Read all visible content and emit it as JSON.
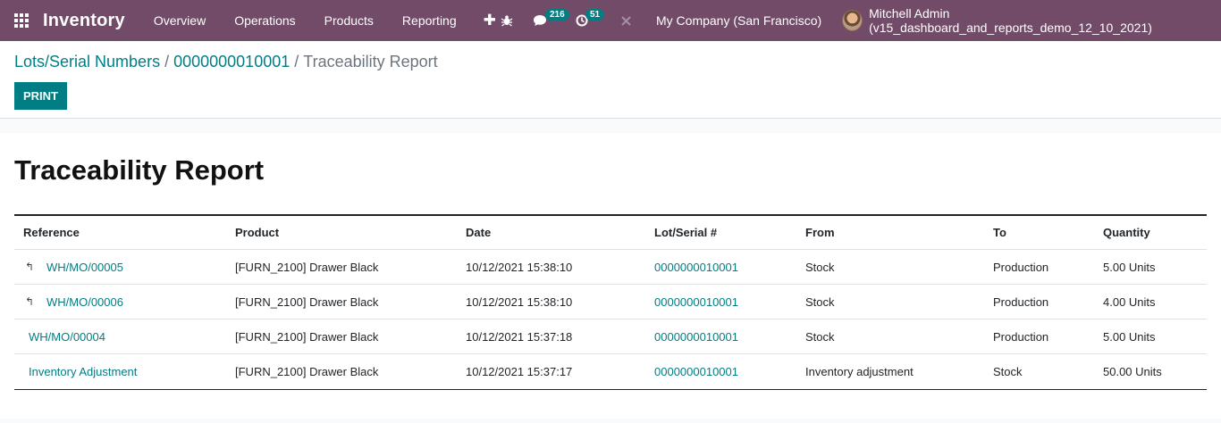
{
  "navbar": {
    "app_title": "Inventory",
    "menu": [
      "Overview",
      "Operations",
      "Products",
      "Reporting"
    ],
    "messages_count": "216",
    "activities_count": "51",
    "company": "My Company (San Francisco)",
    "user": "Mitchell Admin (v15_dashboard_and_reports_demo_12_10_2021)"
  },
  "breadcrumb": {
    "root": "Lots/Serial Numbers",
    "separator": "/",
    "record": "0000000010001",
    "current": "Traceability Report"
  },
  "actions": {
    "print_label": "PRINT"
  },
  "report": {
    "title": "Traceability Report",
    "columns": [
      "Reference",
      "Product",
      "Date",
      "Lot/Serial #",
      "From",
      "To",
      "Quantity"
    ],
    "rows": [
      {
        "reference": "WH/MO/00005",
        "product": "[FURN_2100] Drawer Black",
        "date": "10/12/2021 15:38:10",
        "lot": "0000000010001",
        "from": "Stock",
        "to": "Production",
        "quantity": "5.00 Units",
        "expandable": true
      },
      {
        "reference": "WH/MO/00006",
        "product": "[FURN_2100] Drawer Black",
        "date": "10/12/2021 15:38:10",
        "lot": "0000000010001",
        "from": "Stock",
        "to": "Production",
        "quantity": "4.00 Units",
        "expandable": true
      },
      {
        "reference": "WH/MO/00004",
        "product": "[FURN_2100] Drawer Black",
        "date": "10/12/2021 15:37:18",
        "lot": "0000000010001",
        "from": "Stock",
        "to": "Production",
        "quantity": "5.00 Units",
        "expandable": false
      },
      {
        "reference": "Inventory Adjustment",
        "product": "[FURN_2100] Drawer Black",
        "date": "10/12/2021 15:37:17",
        "lot": "0000000010001",
        "from": "Inventory adjustment",
        "to": "Stock",
        "quantity": "50.00 Units",
        "expandable": false
      }
    ]
  },
  "icons": {
    "apps": "apps-grid-icon",
    "add": "plus-icon",
    "debug": "bug-icon",
    "messages": "chat-icon",
    "activities": "clock-icon",
    "close": "close-icon",
    "expand": "caret-icon"
  },
  "colors": {
    "navbar": "#714B67",
    "accent": "#017E84"
  }
}
